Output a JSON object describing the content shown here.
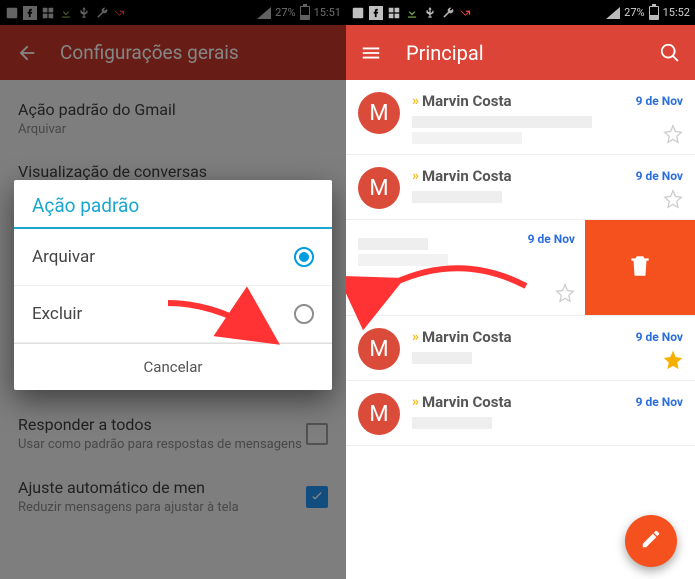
{
  "statusbar": {
    "left_time": "15:51",
    "left_battery": "27%",
    "right_time": "15:52",
    "right_battery": "27%"
  },
  "left": {
    "appbar_title": "Configurações gerais",
    "settings": [
      {
        "title": "Ação padrão do Gmail",
        "sub": "Arquivar"
      },
      {
        "title": "Visualização de conversas"
      },
      {
        "title": "Responder a todos",
        "sub": "Usar como padrão para respostas de mensagens",
        "checkbox": false
      },
      {
        "title": "Ajuste automático de men",
        "sub": "Reduzir mensagens para ajustar à tela",
        "checkbox": true
      }
    ],
    "dialog": {
      "title": "Ação padrão",
      "options": [
        {
          "label": "Arquivar",
          "selected": true
        },
        {
          "label": "Excluir",
          "selected": false
        }
      ],
      "cancel": "Cancelar"
    }
  },
  "right": {
    "appbar_title": "Principal",
    "rows": [
      {
        "avatar": "M",
        "sender": "Marvin Costa",
        "date": "9 de Nov",
        "starred": false
      },
      {
        "avatar": "M",
        "sender": "Marvin Costa",
        "date": "9 de Nov",
        "starred": false
      },
      {
        "swiped": true,
        "date": "9 de Nov",
        "starred": false
      },
      {
        "avatar": "M",
        "sender": "Marvin Costa",
        "date": "9 de Nov",
        "starred": true
      },
      {
        "avatar": "M",
        "sender": "Marvin Costa",
        "date": "9 de Nov",
        "starred": false
      }
    ]
  }
}
